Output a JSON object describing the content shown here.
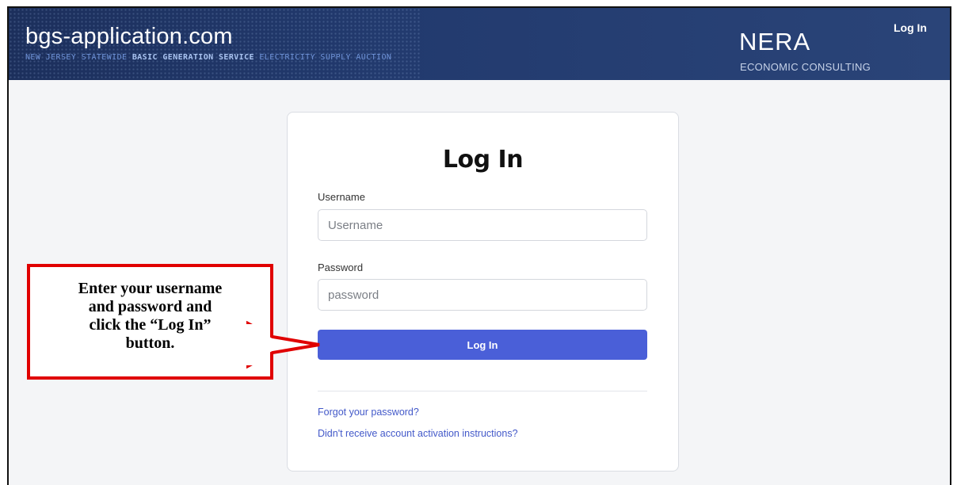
{
  "header": {
    "site_title": "bgs-application.com",
    "tagline_plain_1": "NEW JERSEY STATEWIDE ",
    "tagline_bold": "BASIC GENERATION SERVICE",
    "tagline_plain_2": " ELECTRICITY SUPPLY AUCTION",
    "company_name": "NERA",
    "company_sub": "ECONOMIC CONSULTING",
    "nav_login": "Log In"
  },
  "form": {
    "title": "Log In",
    "username_label": "Username",
    "username_placeholder": "Username",
    "password_label": "Password",
    "password_placeholder": "password",
    "submit_label": "Log In",
    "forgot_link": "Forgot your password?",
    "activation_link": "Didn't receive account activation instructions?"
  },
  "callout": {
    "line1": "Enter your username",
    "line2": "and password and",
    "line3": "click the “Log In”",
    "line4": "button."
  },
  "colors": {
    "header_bg": "#223a6e",
    "button_bg": "#4a5fd8",
    "link": "#4359c9",
    "callout_border": "#e00000"
  }
}
